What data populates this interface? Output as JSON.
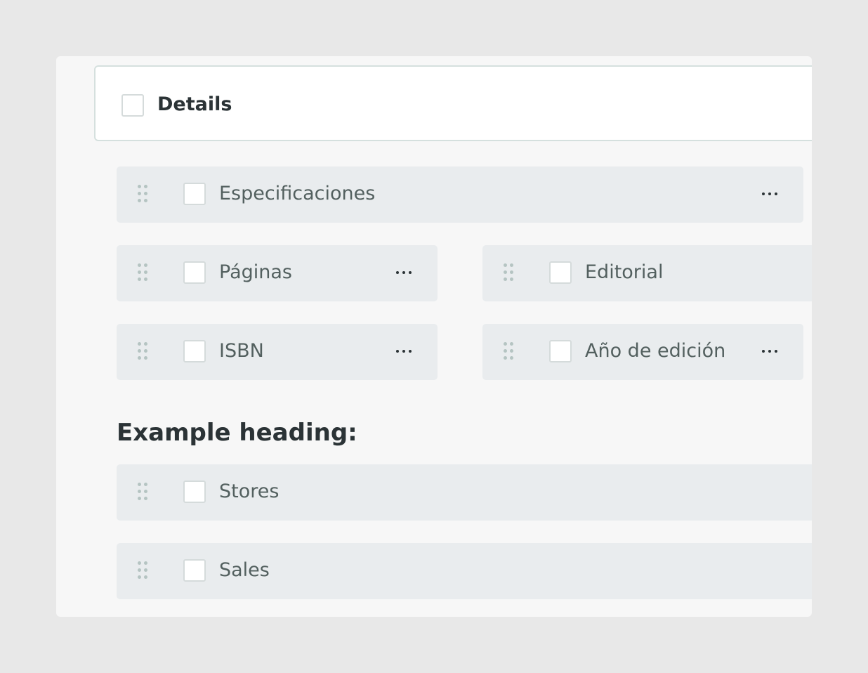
{
  "group": {
    "title": "Details",
    "checked": false
  },
  "fields": {
    "especificaciones": {
      "label": "Especificaciones",
      "icon": "ellipsis-icon"
    },
    "paginas": {
      "label": "Páginas",
      "icon": "ellipsis-icon"
    },
    "editorial": {
      "label": "Editorial"
    },
    "isbn": {
      "label": "ISBN",
      "icon": "ellipsis-icon"
    },
    "ano_edicion": {
      "label": "Año de edición",
      "icon": "ellipsis-icon"
    },
    "stores": {
      "label": "Stores"
    },
    "sales": {
      "label": "Sales"
    }
  },
  "section": {
    "heading": "Example heading:"
  },
  "colors": {
    "background": "#e8e8e8",
    "panel": "#f7f7f7",
    "field_bg": "#e9ecee",
    "text_dark": "#2b3336",
    "text_field": "#53605f",
    "handle_dots": "#b5c4c2"
  }
}
